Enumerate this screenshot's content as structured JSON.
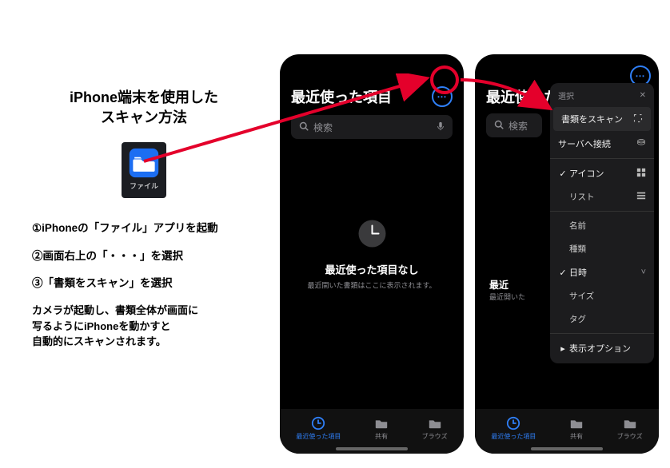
{
  "title_line1": "iPhone端末を使用した",
  "title_line2": "スキャン方法",
  "app_icon_label": "ファイル",
  "steps": {
    "s1": "①iPhoneの「ファイル」アプリを起動",
    "s2": "②画面右上の「・・・」を選択",
    "s3": "③「書類をスキャン」を選択"
  },
  "note_line1": "カメラが起動し、書類全体が画面に",
  "note_line2": "写るようにiPhoneを動かすと",
  "note_line3": "自動的にスキャンされます。",
  "phone": {
    "header_title": "最近使った項目",
    "header_title_cut": "最近使った",
    "search_placeholder": "検索",
    "empty_title": "最近使った項目なし",
    "empty_sub": "最近開いた書類はここに表示されます。",
    "empty_title_cut": "最近",
    "empty_sub_cut": "最近開いた",
    "tabs": {
      "recent": "最近使った項目",
      "shared": "共有",
      "browse": "ブラウズ"
    }
  },
  "menu": {
    "header": "選択",
    "scan": "書類をスキャン",
    "server": "サーバへ接続",
    "icon_view": "アイコン",
    "list_view": "リスト",
    "name": "名前",
    "kind": "種類",
    "date": "日時",
    "size": "サイズ",
    "tag": "タグ",
    "display_options": "表示オプション"
  }
}
